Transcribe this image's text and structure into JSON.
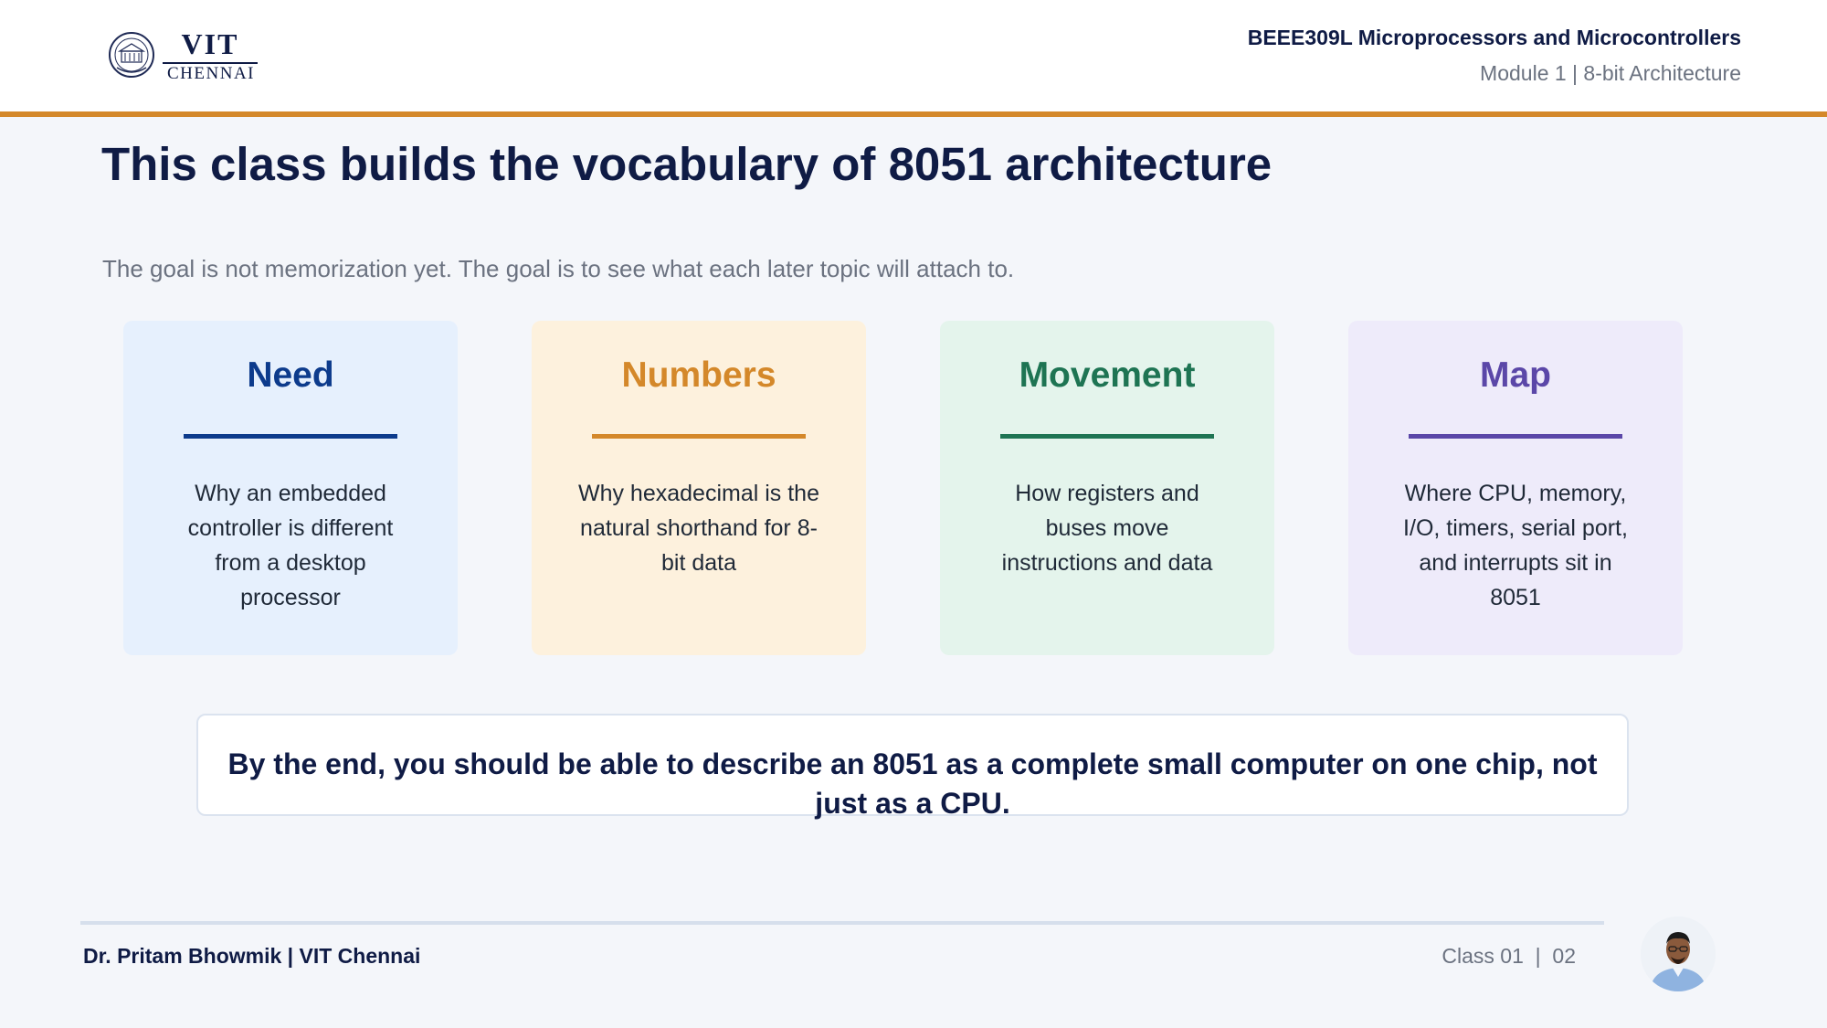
{
  "header": {
    "logo_text": "VIT",
    "logo_subtext": "CHENNAI",
    "course": "BEEE309L Microprocessors and Microcontrollers",
    "module": "Module 1 | 8-bit Architecture"
  },
  "title": "This class builds the vocabulary of 8051 architecture",
  "subtitle": "The goal is not memorization yet. The goal is to see what each later topic will attach to.",
  "cards": [
    {
      "title": "Need",
      "body": "Why an embedded controller is different from a desktop processor",
      "accent": "#0d3b8c",
      "bg": "#e6f0fd"
    },
    {
      "title": "Numbers",
      "body": "Why hexadecimal is the natural shorthand for 8-bit data",
      "accent": "#d4882a",
      "bg": "#fdf1dd"
    },
    {
      "title": "Movement",
      "body": "How registers and buses move instructions and data",
      "accent": "#1e7453",
      "bg": "#e4f4ec"
    },
    {
      "title": "Map",
      "body": "Where CPU, memory, I/O, timers, serial port, and interrupts sit in 8051",
      "accent": "#5b47a8",
      "bg": "#eeebfa"
    }
  ],
  "conclusion": "By the end, you should be able to describe an 8051 as a complete small computer on one chip, not just as a CPU.",
  "footer": {
    "presenter": "Dr. Pritam Bhowmik | VIT Chennai",
    "class_label": "Class 01  |  02"
  },
  "colors": {
    "header_rule": "#d4882a",
    "navy": "#0f1b45"
  }
}
